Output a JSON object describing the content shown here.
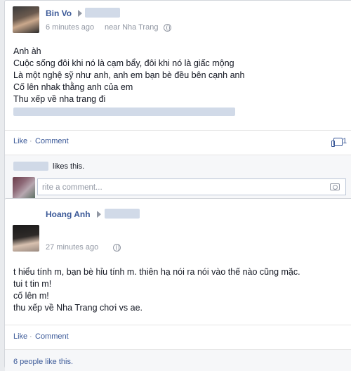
{
  "post1": {
    "author": "Bin Vo",
    "time": "6 minutes ago",
    "location": "near Nha Trang",
    "lines": [
      "Anh àh",
      "Cuộc sống đôi khi nó là cạm bẩy, đôi khi nó là giấc mộng",
      "Là một nghệ sỹ như anh, anh em bạn bè đều bên cạnh anh",
      "Cố lên nhak thằng anh của em",
      "Thu xếp về nha trang đi"
    ],
    "actions": {
      "like": "Like",
      "separator": "·",
      "comment": "Comment"
    },
    "like_count": "1",
    "likes_text": "likes this.",
    "comment_placeholder": "Write a comment...",
    "comment_placeholder_visible": "rite a comment..."
  },
  "post2": {
    "author": "Hoang Anh",
    "time": "27 minutes ago",
    "lines": [
      "t hiểu tính m, bạn bè hỉu tính m. thiên hạ nói ra nói vào thế nào cũng mặc.",
      "tui t tin m!",
      "cố lên m!",
      "thu xếp về Nha Trang chơi vs ae."
    ],
    "actions": {
      "like": "Like",
      "separator": "·",
      "comment": "Comment"
    },
    "likes_text": "6 people like this."
  },
  "icons": {
    "arrow": "right-triangle-icon",
    "audience": "globe-icon",
    "like": "thumbs-up-icon",
    "photo": "camera-icon"
  },
  "colors": {
    "link": "#3b5998",
    "meta": "#9197a3",
    "background": "#e9ebee"
  }
}
